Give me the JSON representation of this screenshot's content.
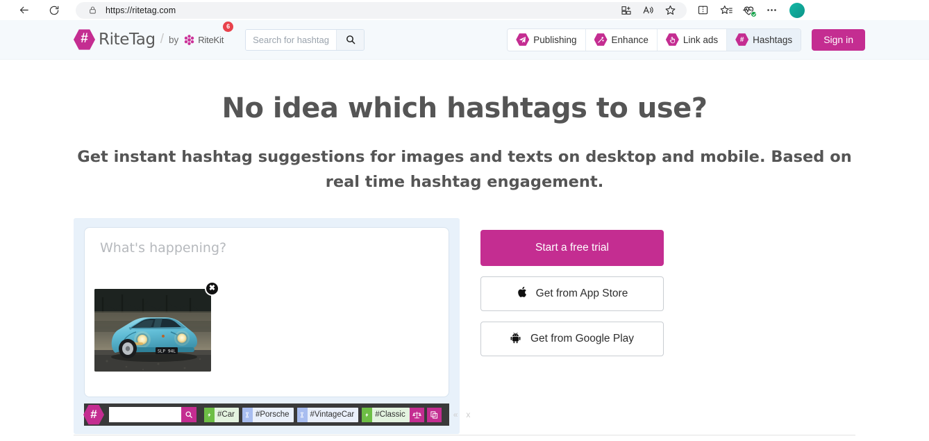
{
  "browser": {
    "url": "https://ritetag.com",
    "back_label": "Back",
    "refresh_label": "Refresh",
    "lock_icon": "lock-icon",
    "toolbar_icons": [
      {
        "name": "split-screen-add-icon",
        "label": "App available"
      },
      {
        "name": "read-aloud-icon",
        "label": "Read aloud"
      },
      {
        "name": "favorite-star-icon",
        "label": "Add this page to favorites"
      },
      {
        "name": "split-screen-icon",
        "label": "Split screen"
      },
      {
        "name": "collections-icon",
        "label": "Collections"
      },
      {
        "name": "browser-essentials-icon",
        "label": "Browser essentials"
      },
      {
        "name": "settings-more-icon",
        "label": "Settings and more"
      }
    ],
    "profile_label": "Profile"
  },
  "header": {
    "brand": {
      "hex_glyph": "#",
      "name": "RiteTag",
      "separator": "/",
      "by_label": "by",
      "parent_name": "RiteKit",
      "badge_count": "6"
    },
    "search": {
      "placeholder": "Search for hashtags",
      "value": "",
      "button_icon": "search-icon"
    },
    "nav_items": [
      {
        "label": "Publishing",
        "icon": "paper-plane-icon",
        "active": false
      },
      {
        "label": "Enhance",
        "icon": "magic-wand-icon",
        "active": false
      },
      {
        "label": "Link ads",
        "icon": "pointing-hand-icon",
        "active": false
      },
      {
        "label": "Hashtags",
        "icon": "hashtag-icon",
        "active": true
      }
    ],
    "sign_in_label": "Sign in"
  },
  "hero": {
    "title": "No idea which hashtags to use?",
    "subtitle": "Get instant hashtag suggestions for images and texts on desktop and mobile. Based on real time hashtag engagement."
  },
  "composer": {
    "placeholder": "What's happening?",
    "attachment": {
      "alt": "Light blue classic Porsche 911 sports car with headlights on, parked in front of bare winter trees",
      "plate_text": "SLP 94L",
      "remove_label": "✖"
    }
  },
  "hashtag_toolbar": {
    "hex_glyph": "#",
    "search": {
      "placeholder": "",
      "value": "",
      "button_icon": "search-icon"
    },
    "tags": [
      {
        "label": "#Car",
        "grade": "green",
        "icon": "lightning-bolt-icon"
      },
      {
        "label": "#Porsche",
        "grade": "blue",
        "icon": "hourglass-icon"
      },
      {
        "label": "#VintageCar",
        "grade": "blue",
        "icon": "hourglass-icon"
      },
      {
        "label": "#Classic",
        "grade": "green",
        "icon": "lightning-bolt-icon"
      }
    ],
    "actions": [
      {
        "name": "compare-scales-icon",
        "label": "Compare hashtags"
      },
      {
        "name": "copy-tags-icon",
        "label": "Copy hashtags"
      }
    ],
    "collapse_label": "«",
    "close_label": "x"
  },
  "cta": {
    "start_trial_label": "Start a free trial",
    "app_store_label": "Get from App Store",
    "app_store_icon": "apple-icon",
    "google_play_label": "Get from Google Play",
    "google_play_icon": "android-icon"
  },
  "colors": {
    "brand_magenta": "#c42d91",
    "header_bg": "#f5f9fc",
    "card_bg": "#e8f1fa",
    "toolbar_bg": "#3a3a3a",
    "green_grade": "#6dbe45",
    "blue_grade": "#a8bdf0",
    "badge_red": "#e8424c",
    "text_gray": "#555555"
  }
}
